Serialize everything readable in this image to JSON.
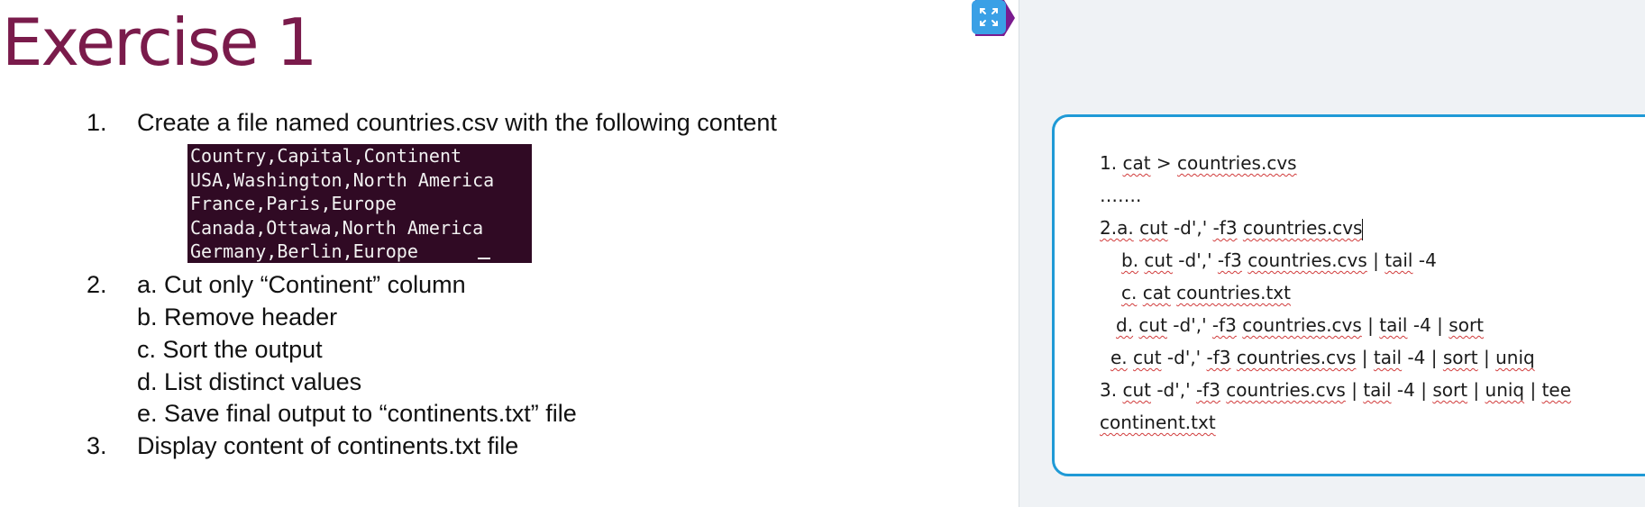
{
  "slide": {
    "title": "Exercise 1",
    "items": {
      "item1": {
        "num": "1.",
        "text": "Create a file named countries.csv with the following content"
      },
      "item2": {
        "num": "2.",
        "sub_a": "a. Cut only “Continent” column",
        "sub_b": "b. Remove header",
        "sub_c": "c. Sort the output",
        "sub_d": "d. List distinct values",
        "sub_e": "e. Save final output to “continents.txt” file"
      },
      "item3": {
        "num": "3.",
        "text": "Display content of continents.txt file"
      }
    },
    "terminal_lines": [
      "Country,Capital,Continent",
      "USA,Washington,North America",
      "France,Paris,Europe",
      "Canada,Ottawa,North America",
      "Germany,Berlin,Europe"
    ]
  },
  "answers": {
    "l1": {
      "prefix": "1.",
      "cmd": "cat",
      "sep": ">",
      "file": "countries.cvs"
    },
    "l2": "…….",
    "l3": {
      "label": "2.a.",
      "cmd": "cut",
      "opt1": "-d','",
      "opt2": "-f3",
      "file": "countries.cvs"
    },
    "l4": {
      "label": "b.",
      "cmd": "cut",
      "opt1": "-d','",
      "opt2": "-f3",
      "file": "countries.cvs",
      "pipe": "|",
      "tail": "tail",
      "n": "-4"
    },
    "l5": {
      "label": "c.",
      "cmd": "cat",
      "file": "countries.txt"
    },
    "l6": {
      "label": "d.",
      "cmd": "cut",
      "opt1": "-d','",
      "opt2": "-f3",
      "file": "countries.cvs",
      "pipe1": "|",
      "tail": "tail",
      "n": "-4",
      "pipe2": "|",
      "sort": "sort"
    },
    "l7": {
      "label": "e.",
      "cmd": "cut",
      "opt1": "-d','",
      "opt2": "-f3",
      "file": "countries.cvs",
      "pipe1": "|",
      "tail": "tail",
      "n": "-4",
      "pipe2": "|",
      "sort": "sort",
      "pipe3": "|",
      "uniq": "uniq"
    },
    "l8": {
      "label": "3.",
      "cmd": "cut",
      "opt1": "-d','",
      "opt2": "-f3",
      "file": "countries.cvs",
      "pipe1": "|",
      "tail": "tail",
      "n": "-4",
      "pipe2": "|",
      "sort": "sort",
      "pipe3": "|",
      "uniq": "uniq",
      "pipe4": "|",
      "tee": "tee"
    },
    "l9": "continent.txt"
  },
  "colors": {
    "title": "#7a1b4b",
    "terminal_bg": "#300a24",
    "answer_border": "#1f9ad6",
    "panel_bg": "#eff2f5"
  },
  "icons": {
    "expand": "expand-arrows-icon"
  }
}
